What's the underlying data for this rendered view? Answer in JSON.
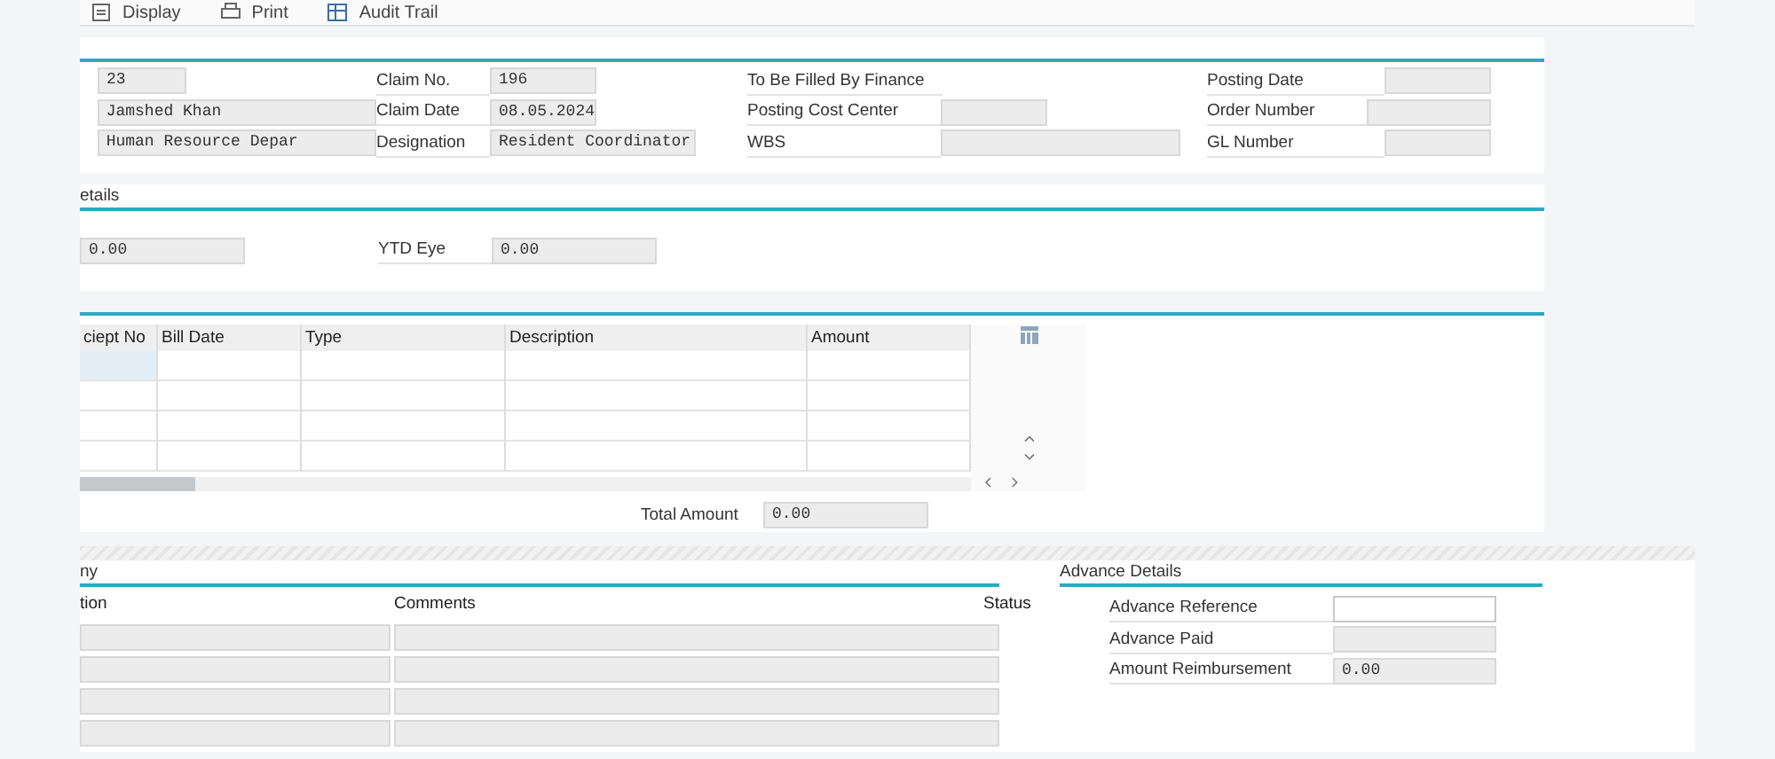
{
  "toolbar": [
    {
      "label": "Display",
      "kind": "display"
    },
    {
      "label": "Print",
      "kind": "print"
    },
    {
      "label": "Audit Trail",
      "kind": "audit"
    }
  ],
  "header": {
    "left": [
      {
        "value": "23",
        "disabled": true
      },
      {
        "value": "Jamshed Khan",
        "disabled": true
      },
      {
        "value": "Human Resource Depar",
        "disabled": true
      }
    ],
    "middle": [
      {
        "label": "Claim No.",
        "value": "196",
        "disabled": true
      },
      {
        "label": "Claim Date",
        "value": "08.05.2024",
        "disabled": true
      },
      {
        "label": "Designation",
        "value": "Resident Coordinator",
        "disabled": true
      }
    ],
    "finance_title": "To Be Filled By Finance",
    "finance": [
      {
        "label": "Posting Cost Center",
        "disabled": true
      },
      {
        "label": "WBS",
        "disabled": true
      }
    ],
    "right": [
      {
        "label": "Posting Date",
        "disabled": true
      },
      {
        "label": "Order Number",
        "disabled": true
      },
      {
        "label": "GL Number",
        "disabled": true
      }
    ]
  },
  "details": {
    "title": "etails",
    "fields": [
      {
        "value": "0.00",
        "disabled": true
      },
      {
        "label": "YTD Eye",
        "value": "0.00",
        "disabled": true
      }
    ]
  },
  "bills": {
    "columns": [
      "ciept No",
      "Bill Date",
      "Type",
      "Description",
      "Amount"
    ],
    "rows": [
      {
        "focused": true
      },
      {
        "focused": false
      },
      {
        "focused": false
      },
      {
        "focused": false
      }
    ],
    "total": {
      "label": "Total Amount",
      "value": "0.00",
      "disabled": true
    }
  },
  "approval": {
    "title": "ny",
    "columns": [
      "tion",
      "Comments",
      "Status"
    ],
    "rows": [
      {
        "disabled": true
      },
      {
        "disabled": true
      },
      {
        "disabled": true
      },
      {
        "disabled": true
      }
    ]
  },
  "advance": {
    "title": "Advance Details",
    "fields": [
      {
        "label": "Advance Reference",
        "disabled": false
      },
      {
        "label": "Advance Paid",
        "disabled": true
      },
      {
        "label": "Amount Reimbursement",
        "value": "0.00",
        "disabled": true
      }
    ]
  }
}
